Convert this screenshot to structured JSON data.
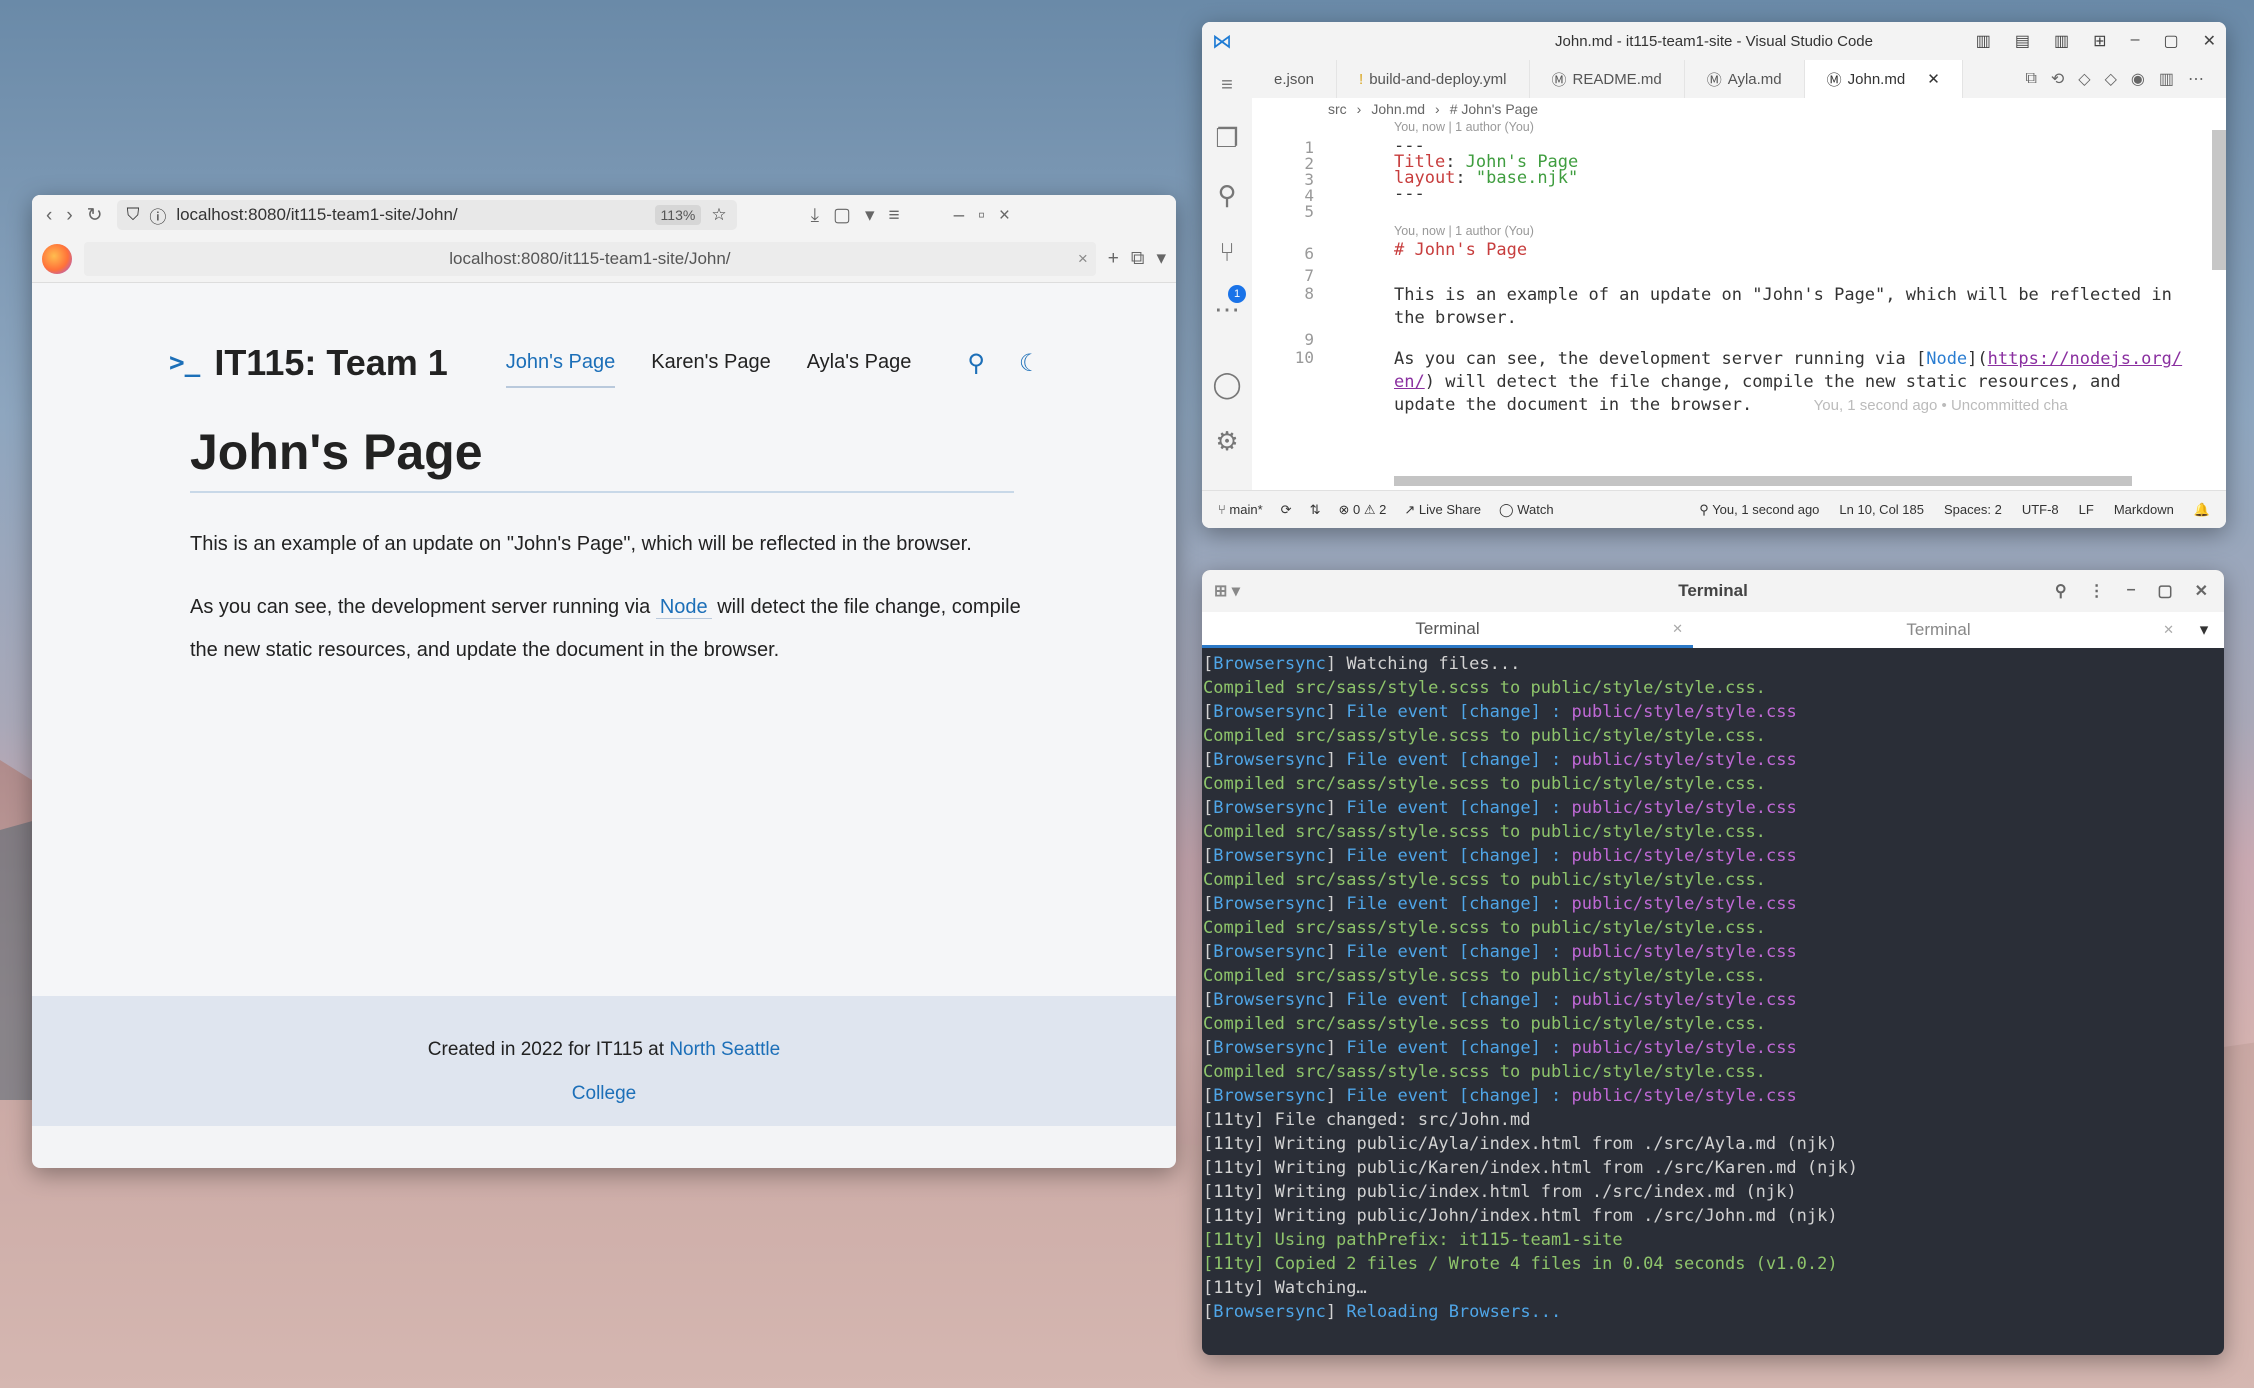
{
  "firefox": {
    "url": "localhost:8080/it115-team1-site/John/",
    "zoom": "113%",
    "tab_url": "localhost:8080/it115-team1-site/John/"
  },
  "site": {
    "brand_prompt": ">_",
    "brand": "IT115: Team 1",
    "nav": [
      "John's Page",
      "Karen's Page",
      "Ayla's Page"
    ],
    "title": "John's Page",
    "p1": "This is an example of an update on \"John's Page\", which will be reflected in the browser.",
    "p2_before": "As you can see, the development server running via",
    "p2_link": "Node",
    "p2_after": "will detect the file change, compile the new static resources, and update the document in the browser.",
    "footer_text": "Created in 2022 for IT115 at",
    "footer_link1": "North Seattle",
    "footer_link2": "College"
  },
  "vscode": {
    "title": "John.md - it115-team1-site - Visual Studio Code",
    "tabs": [
      "e.json",
      "build-and-deploy.yml",
      "README.md",
      "Ayla.md",
      "John.md"
    ],
    "crumb": [
      "src",
      "John.md",
      "# John's Page"
    ],
    "blame1": "You, now | 1 author (You)",
    "blame2": "You, now | 1 author (You)",
    "inline_blame": "You, 1 second ago • Uncommitted cha",
    "badge": "1",
    "status": {
      "branch": "main*",
      "errors": "0",
      "warnings": "2",
      "live": "Live Share",
      "watch": "Watch",
      "blame": "You, 1 second ago",
      "pos": "Ln 10, Col 185",
      "spaces": "Spaces: 2",
      "enc": "UTF-8",
      "eol": "LF",
      "lang": "Markdown"
    }
  },
  "terminal": {
    "title": "Terminal",
    "tabs": [
      "Terminal",
      "Terminal"
    ]
  },
  "colors": {
    "accent": "#1c6fb8",
    "term_bg": "#2a2e37"
  }
}
